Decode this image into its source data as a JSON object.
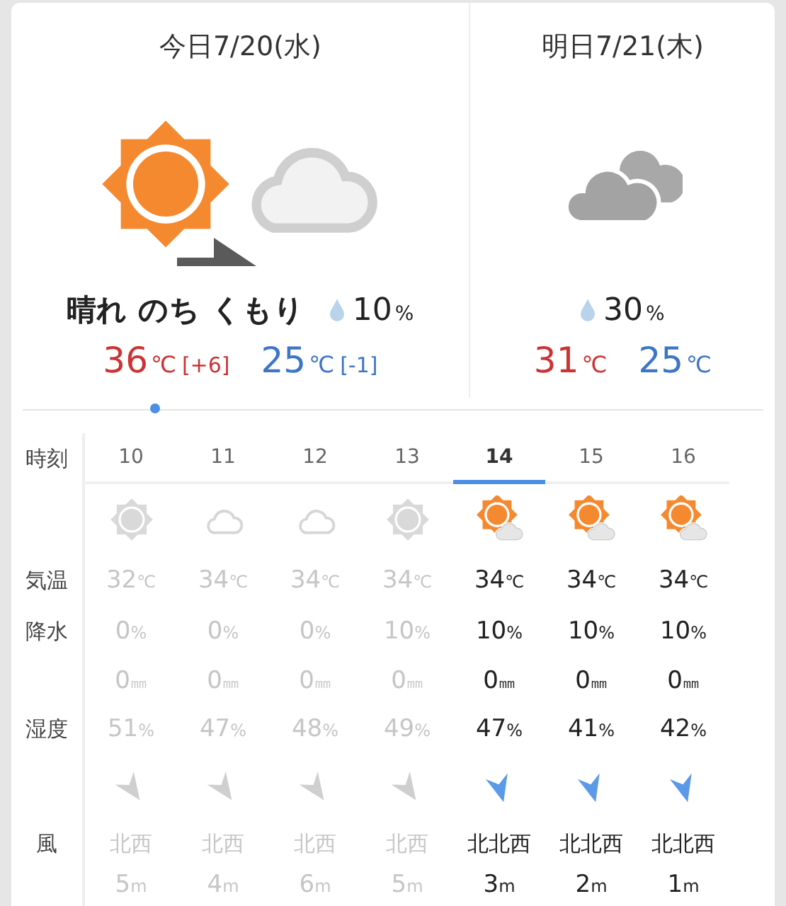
{
  "days": [
    {
      "title": "今日7/20(水)",
      "kind": "sunny_then_cloudy",
      "weather": "晴れ のち くもり",
      "rain_chance": "10",
      "rain_unit": "%",
      "high": "36",
      "high_unit": "℃",
      "high_diff": "[+6]",
      "low": "25",
      "low_unit": "℃",
      "low_diff": "[-1]"
    },
    {
      "title": "明日7/21(木)",
      "kind": "cloudy_dark",
      "rain_chance": "30",
      "rain_unit": "%",
      "high": "31",
      "high_unit": "℃",
      "low": "25",
      "low_unit": "℃"
    }
  ],
  "row_labels": {
    "time": "時刻",
    "temp": "気温",
    "rain": "降水",
    "humidity": "湿度",
    "wind": "風"
  },
  "hours": [
    {
      "time": "10",
      "selected": false,
      "past": true,
      "kind": "sunny",
      "temp": "32",
      "temp_unit": "℃",
      "rain": "0",
      "rain_unit": "%",
      "amount": "0",
      "amount_unit": "㎜",
      "humidity": "51",
      "humidity_unit": "%",
      "wind": {
        "kind": "nw",
        "direction": "北西",
        "speed": "5",
        "unit": "m"
      }
    },
    {
      "time": "11",
      "selected": false,
      "past": true,
      "kind": "cloudy",
      "temp": "34",
      "temp_unit": "℃",
      "rain": "0",
      "rain_unit": "%",
      "amount": "0",
      "amount_unit": "㎜",
      "humidity": "47",
      "humidity_unit": "%",
      "wind": {
        "kind": "nw",
        "direction": "北西",
        "speed": "4",
        "unit": "m"
      }
    },
    {
      "time": "12",
      "selected": false,
      "past": true,
      "kind": "cloudy",
      "temp": "34",
      "temp_unit": "℃",
      "rain": "0",
      "rain_unit": "%",
      "amount": "0",
      "amount_unit": "㎜",
      "humidity": "48",
      "humidity_unit": "%",
      "wind": {
        "kind": "nw",
        "direction": "北西",
        "speed": "6",
        "unit": "m"
      }
    },
    {
      "time": "13",
      "selected": false,
      "past": true,
      "kind": "sunny",
      "temp": "34",
      "temp_unit": "℃",
      "rain": "10",
      "rain_unit": "%",
      "amount": "0",
      "amount_unit": "㎜",
      "humidity": "49",
      "humidity_unit": "%",
      "wind": {
        "kind": "nw",
        "direction": "北西",
        "speed": "5",
        "unit": "m"
      }
    },
    {
      "time": "14",
      "selected": true,
      "past": false,
      "kind": "sunny_cloudy",
      "temp": "34",
      "temp_unit": "℃",
      "rain": "10",
      "rain_unit": "%",
      "amount": "0",
      "amount_unit": "㎜",
      "humidity": "47",
      "humidity_unit": "%",
      "wind": {
        "kind": "nnw",
        "direction": "北北西",
        "speed": "3",
        "unit": "m"
      }
    },
    {
      "time": "15",
      "selected": false,
      "past": false,
      "kind": "sunny_cloudy",
      "temp": "34",
      "temp_unit": "℃",
      "rain": "10",
      "rain_unit": "%",
      "amount": "0",
      "amount_unit": "㎜",
      "humidity": "41",
      "humidity_unit": "%",
      "wind": {
        "kind": "nnw",
        "direction": "北北西",
        "speed": "2",
        "unit": "m"
      }
    },
    {
      "time": "16",
      "selected": false,
      "past": false,
      "kind": "sunny_cloudy",
      "temp": "34",
      "temp_unit": "℃",
      "rain": "10",
      "rain_unit": "%",
      "amount": "0",
      "amount_unit": "㎜",
      "humidity": "42",
      "humidity_unit": "%",
      "wind": {
        "kind": "nnw",
        "direction": "北北西",
        "speed": "1",
        "unit": "m"
      }
    }
  ]
}
